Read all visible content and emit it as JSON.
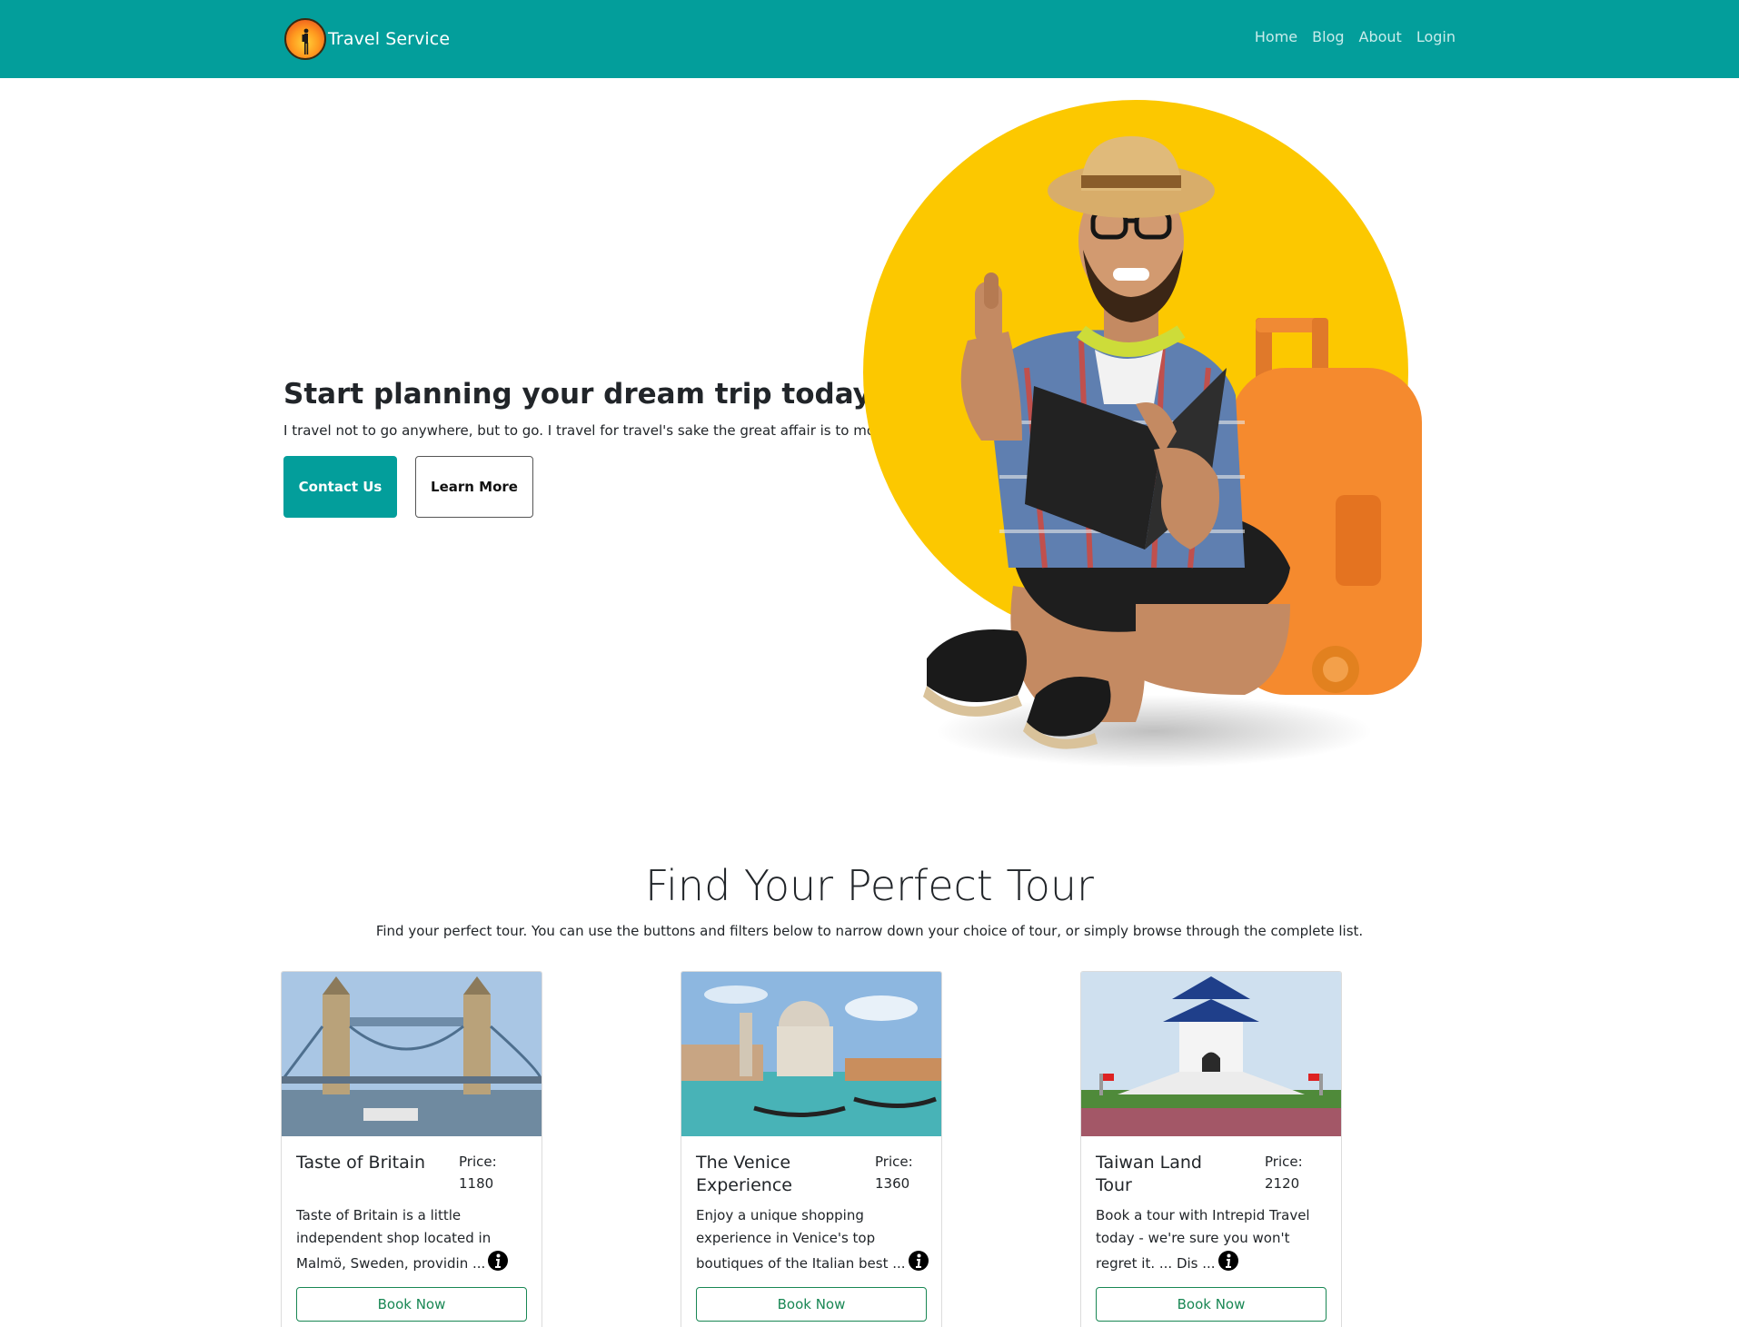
{
  "navbar": {
    "brand": "Travel Service",
    "links": [
      "Home",
      "Blog",
      "About",
      "Login"
    ]
  },
  "hero": {
    "title": "Start planning your dream trip today!",
    "subtitle": "I travel not to go anywhere, but to go. I travel for travel's sake the great affair is to move.",
    "contact_label": "Contact Us",
    "learn_label": "Learn More"
  },
  "tours": {
    "title": "Find Your Perfect Tour",
    "subtitle": "Find your perfect tour. You can use the buttons and filters below to narrow down your choice of tour, or simply browse through the complete list.",
    "price_label": "Price:",
    "book_label": "Book Now",
    "cards": [
      {
        "name": "Taste of Britain",
        "price": "1180",
        "description": "Taste of Britain is a little independent shop located in Malmö, Sweden, providin ..."
      },
      {
        "name": "The Venice Experience",
        "price": "1360",
        "description": "Enjoy a unique shopping experience in Venice's top boutiques of the Italian best ..."
      },
      {
        "name": "Taiwan Land Tour",
        "price": "2120",
        "description": "Book a tour with Intrepid Travel today - we're sure you won't regret it. ... Dis ..."
      }
    ]
  },
  "colors": {
    "navbar": "#039e9b",
    "primary_button": "#039e9b",
    "sun_circle": "#fcc800",
    "book_button": "#198754"
  },
  "icons": {
    "brand": "hiker-sunset-logo",
    "info": "info-circle-icon"
  }
}
